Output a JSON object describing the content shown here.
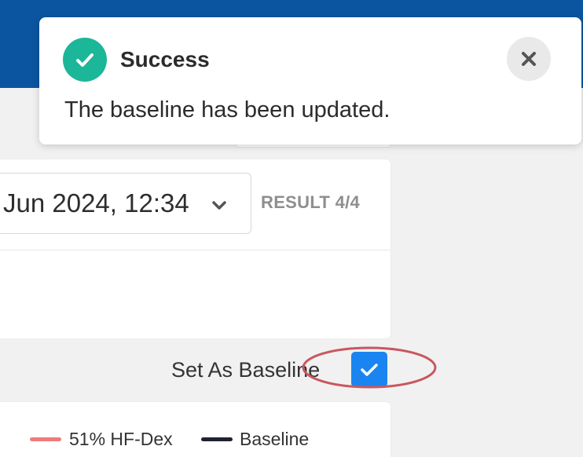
{
  "toast": {
    "title": "Success",
    "message": "The baseline has been updated.",
    "icon": "check-circle-icon",
    "close_icon": "close-icon"
  },
  "result_selector": {
    "date_value": "Jun 2024, 12:34",
    "result_counter": "RESULT 4/4"
  },
  "baseline": {
    "label": "Set As Baseline",
    "checked": true
  },
  "legend": {
    "items": [
      {
        "label": "51% HF-Dex",
        "color": "#f07b7b"
      },
      {
        "label": "Baseline",
        "color": "#1f2233"
      }
    ]
  },
  "colors": {
    "header": "#0b55a0",
    "success": "#1cb698",
    "checkbox": "#1a85f0",
    "annotation": "#c9575f"
  }
}
